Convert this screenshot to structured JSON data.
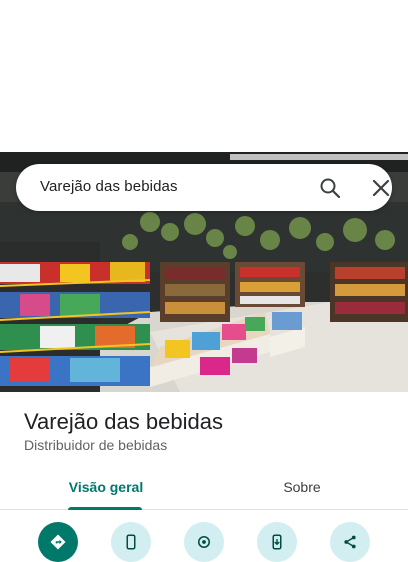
{
  "search": {
    "query": "Varejão das bebidas"
  },
  "place": {
    "name": "Varejão das bebidas",
    "category": "Distribuidor de bebidas"
  },
  "tabs": [
    {
      "label": "Visão geral",
      "selected": true
    },
    {
      "label": "Sobre",
      "selected": false
    }
  ],
  "actions": [
    {
      "icon": "directions-icon"
    },
    {
      "icon": "phone-icon"
    },
    {
      "icon": "location-save-icon"
    },
    {
      "icon": "send-to-phone-icon"
    },
    {
      "icon": "share-icon"
    }
  ],
  "colors": {
    "accent": "#00796b",
    "action_secondary_bg": "#d2eef0"
  }
}
